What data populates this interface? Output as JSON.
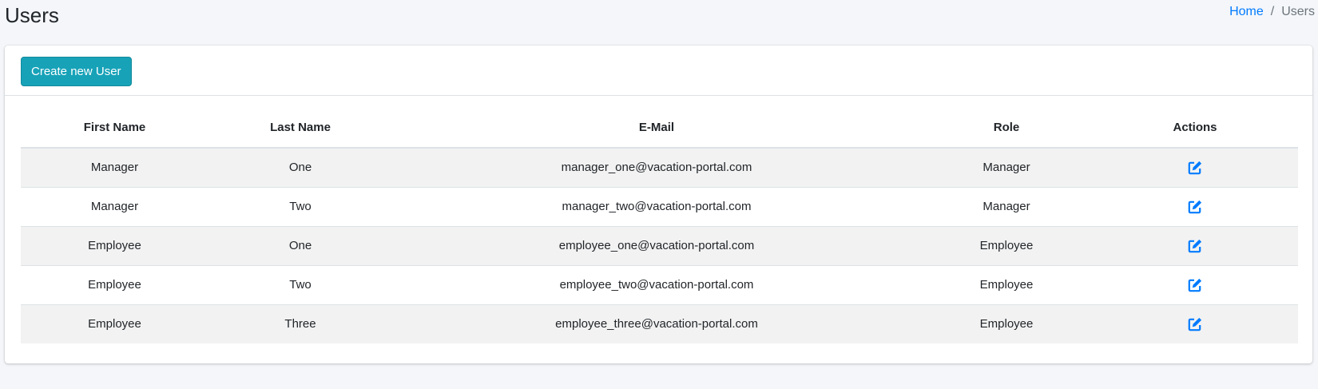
{
  "header": {
    "title": "Users",
    "breadcrumb": {
      "home": "Home",
      "separator": "/",
      "current": "Users"
    }
  },
  "toolbar": {
    "create_label": "Create new User"
  },
  "table": {
    "columns": [
      "First Name",
      "Last Name",
      "E-Mail",
      "Role",
      "Actions"
    ],
    "rows": [
      {
        "first_name": "Manager",
        "last_name": "One",
        "email": "manager_one@vacation-portal.com",
        "role": "Manager",
        "action_icon": "edit-icon"
      },
      {
        "first_name": "Manager",
        "last_name": "Two",
        "email": "manager_two@vacation-portal.com",
        "role": "Manager",
        "action_icon": "edit-icon"
      },
      {
        "first_name": "Employee",
        "last_name": "One",
        "email": "employee_one@vacation-portal.com",
        "role": "Employee",
        "action_icon": "edit-icon"
      },
      {
        "first_name": "Employee",
        "last_name": "Two",
        "email": "employee_two@vacation-portal.com",
        "role": "Employee",
        "action_icon": "edit-icon"
      },
      {
        "first_name": "Employee",
        "last_name": "Three",
        "email": "employee_three@vacation-portal.com",
        "role": "Employee",
        "action_icon": "edit-icon"
      }
    ]
  },
  "colors": {
    "background": "#f4f6f9",
    "link": "#007bff",
    "button": "#17a2b8",
    "stripe": "#f2f2f2",
    "icon": "#007bff"
  }
}
